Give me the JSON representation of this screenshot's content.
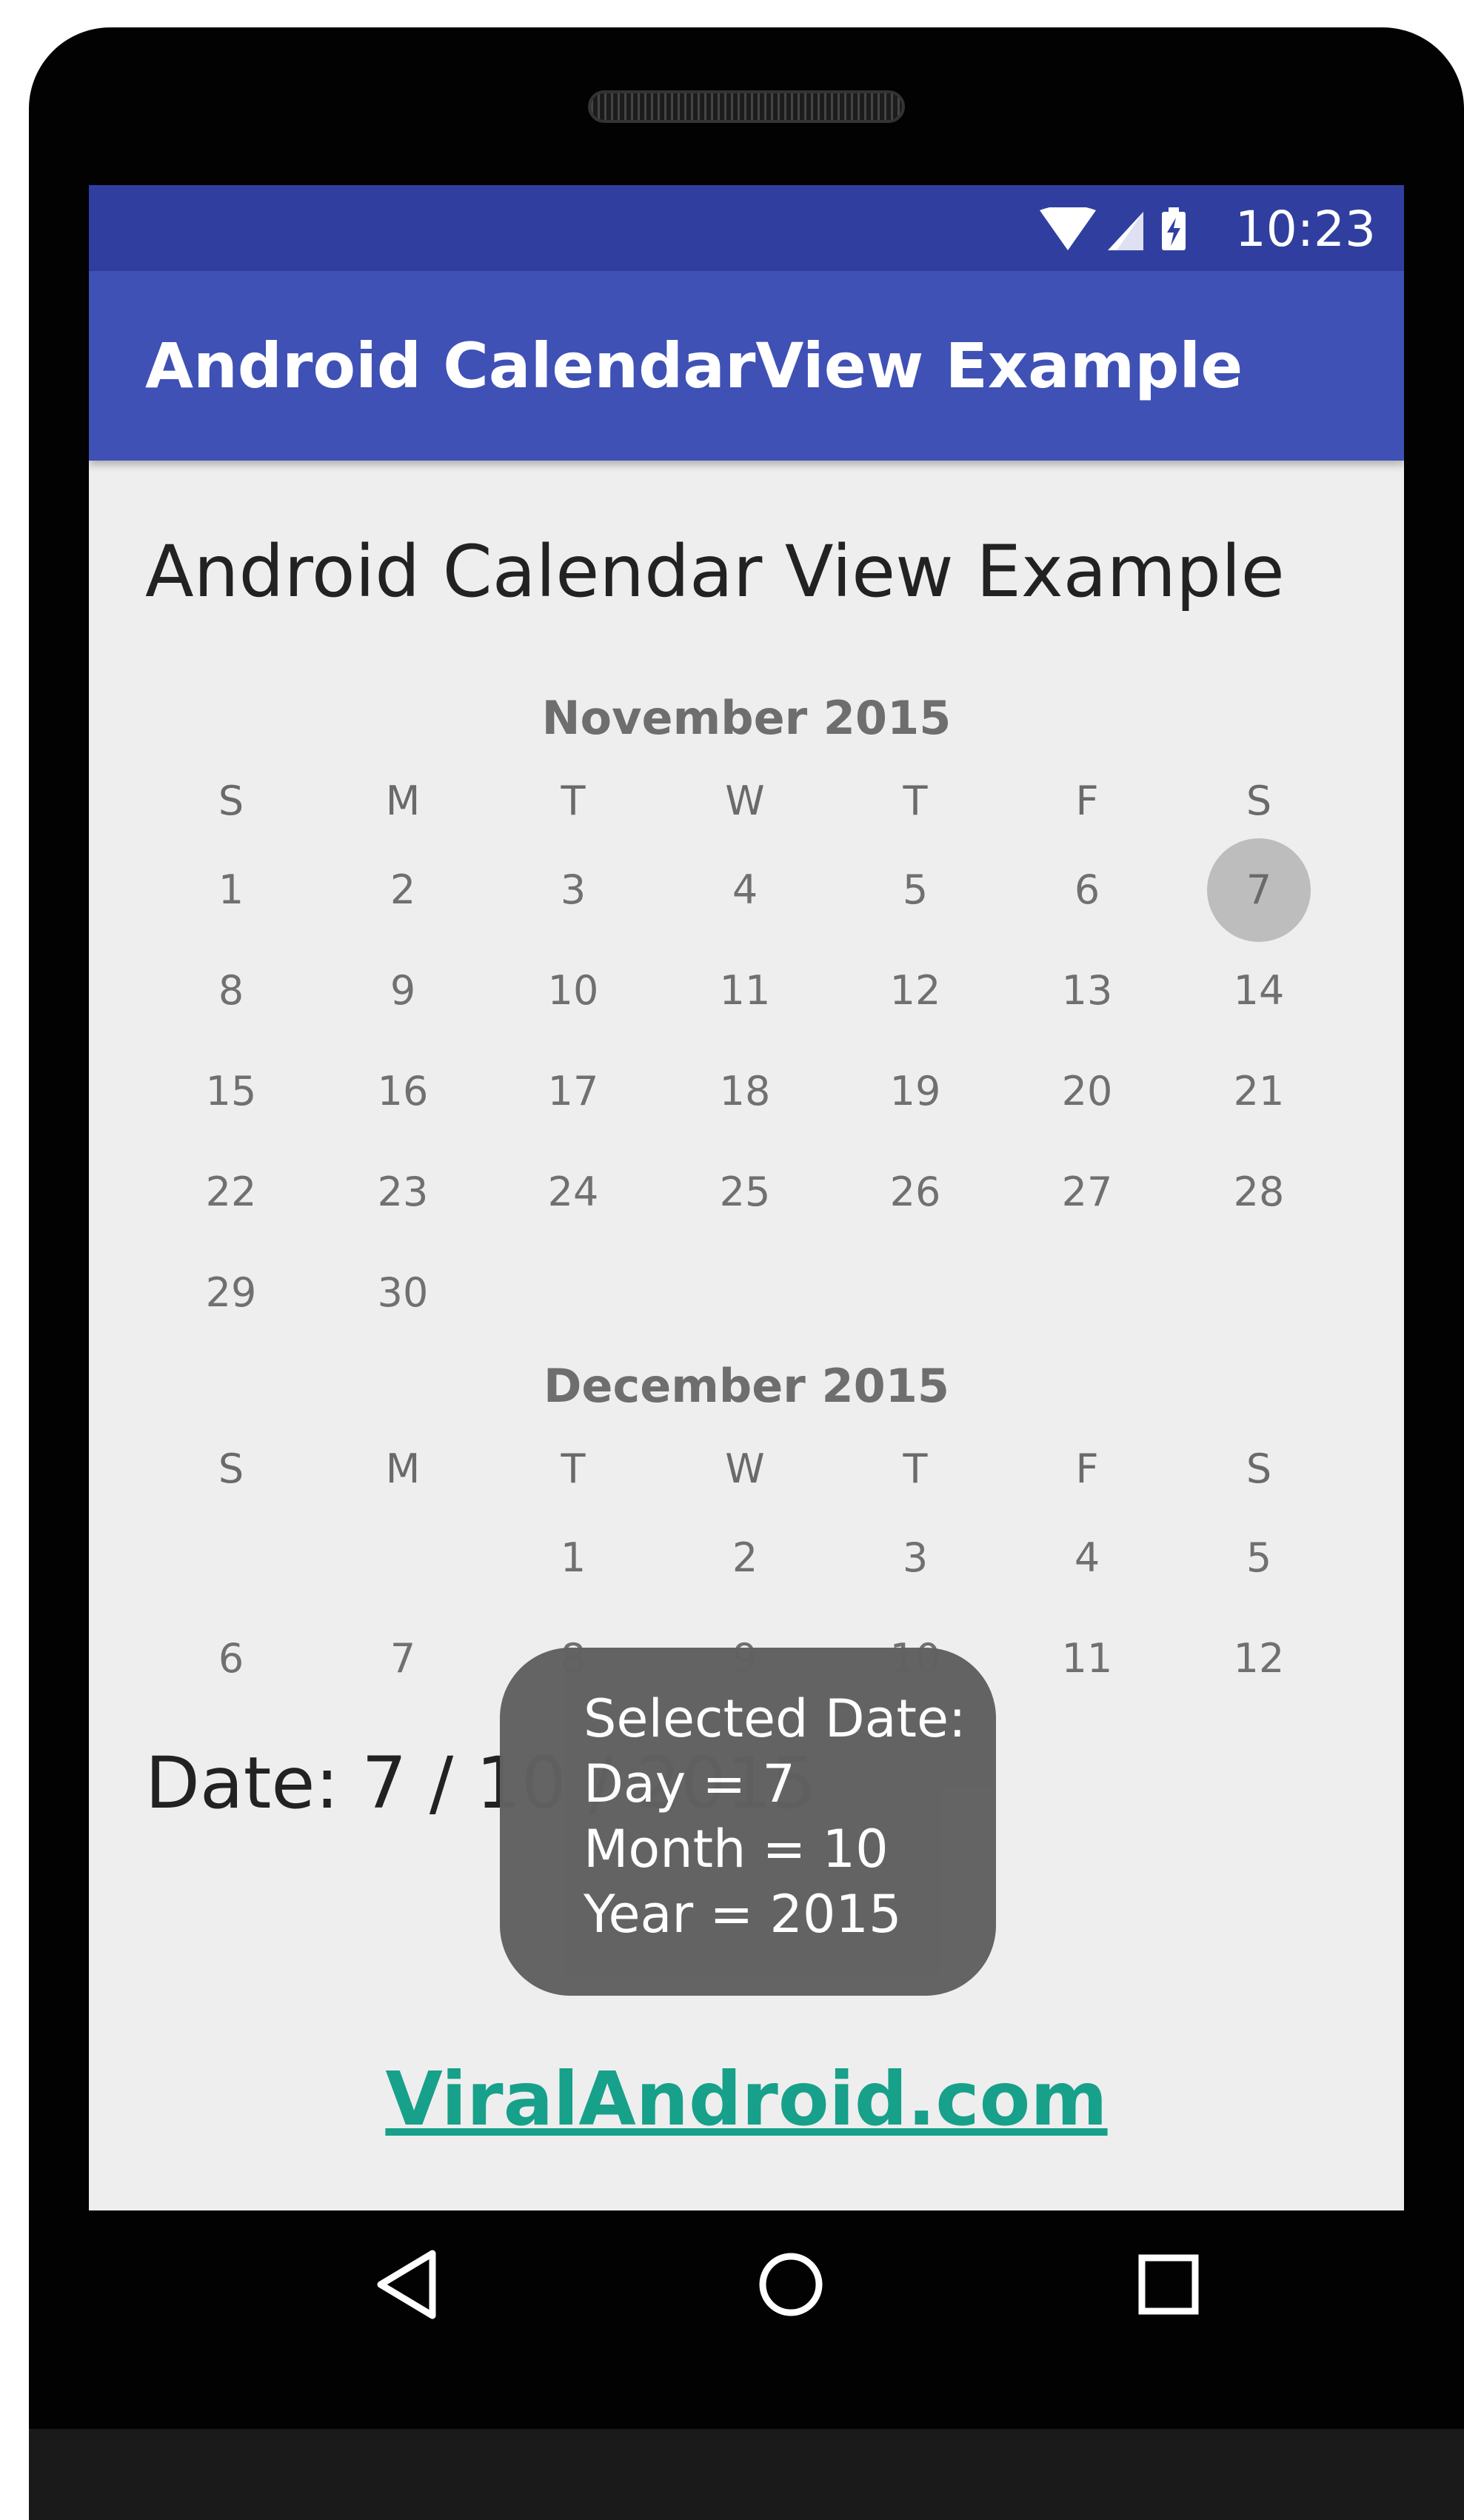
{
  "status_bar": {
    "time": "10:23",
    "icons": [
      "wifi-icon",
      "signal-icon",
      "battery-charging-icon"
    ]
  },
  "app_bar": {
    "title": "Android CalendarView Example"
  },
  "heading": "Android Calendar View Example",
  "calendar": {
    "weekday_labels": [
      "S",
      "M",
      "T",
      "W",
      "T",
      "F",
      "S"
    ],
    "months": [
      {
        "title": "November 2015",
        "weeks": [
          [
            "1",
            "2",
            "3",
            "4",
            "5",
            "6",
            "7"
          ],
          [
            "8",
            "9",
            "10",
            "11",
            "12",
            "13",
            "14"
          ],
          [
            "15",
            "16",
            "17",
            "18",
            "19",
            "20",
            "21"
          ],
          [
            "22",
            "23",
            "24",
            "25",
            "26",
            "27",
            "28"
          ],
          [
            "29",
            "30",
            "",
            "",
            "",
            "",
            ""
          ]
        ],
        "selected_day": "7"
      },
      {
        "title": "December 2015",
        "weeks": [
          [
            "",
            "",
            "1",
            "2",
            "3",
            "4",
            "5"
          ],
          [
            "6",
            "7",
            "8",
            "9",
            "10",
            "11",
            "12"
          ]
        ]
      }
    ]
  },
  "date_label": "Date: 7 / 10 / 2015",
  "toast": {
    "lines": [
      "Selected Date:",
      "Day = 7",
      "Month = 10",
      "Year = 2015"
    ]
  },
  "link": "ViralAndroid.com",
  "nav_bar": {
    "buttons": [
      "back-icon",
      "home-icon",
      "recents-icon"
    ]
  },
  "colors": {
    "status_bar": "#303f9f",
    "app_bar": "#3f51b5",
    "background": "#eeeeee",
    "toast": "#616161",
    "link": "#17a08a",
    "selected_day": "#bdbdbd"
  }
}
